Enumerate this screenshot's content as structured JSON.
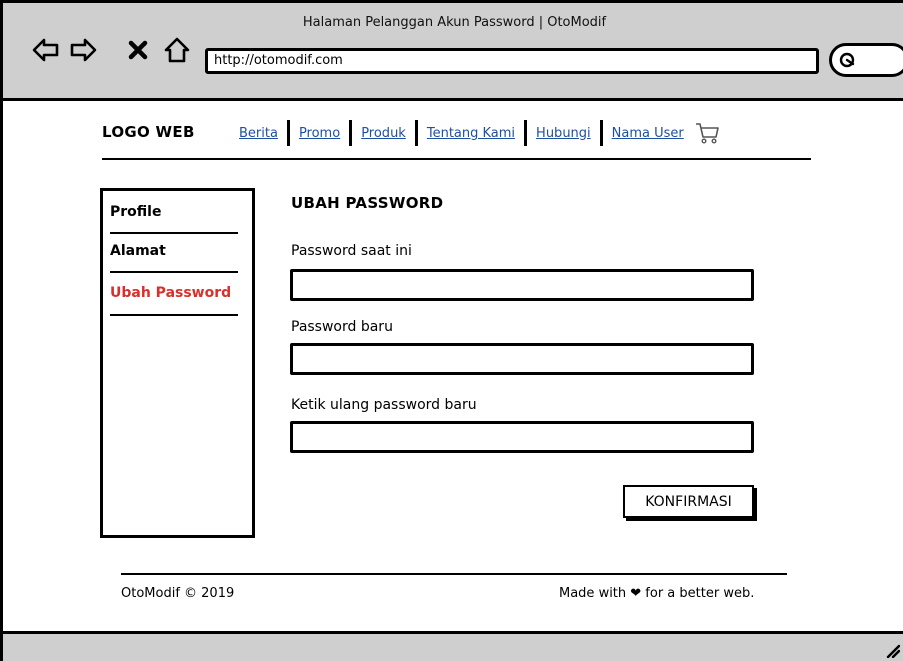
{
  "browser": {
    "window_title": "Halaman Pelanggan Akun Password | OtoModif",
    "url": "http://otomodif.com",
    "icons": {
      "back": "back-arrow-icon",
      "forward": "forward-arrow-icon",
      "stop": "close-icon",
      "home": "home-icon",
      "search": "search-icon"
    }
  },
  "header": {
    "logo": "LOGO WEB",
    "nav": [
      {
        "label": "Berita"
      },
      {
        "label": "Promo"
      },
      {
        "label": "Produk"
      },
      {
        "label": "Tentang Kami"
      },
      {
        "label": "Hubungi"
      },
      {
        "label": "Nama User"
      }
    ],
    "cart_icon": "cart-icon",
    "link_color": "#1f4fa3"
  },
  "sidebar": {
    "items": [
      {
        "label": "Profile",
        "active": false
      },
      {
        "label": "Alamat",
        "active": false
      },
      {
        "label": "Ubah Password",
        "active": true
      }
    ],
    "active_color": "#d9302c"
  },
  "form": {
    "title": "UBAH PASSWORD",
    "fields": [
      {
        "label": "Password saat ini",
        "value": ""
      },
      {
        "label": "Password baru",
        "value": ""
      },
      {
        "label": "Ketik ulang password baru",
        "value": ""
      }
    ],
    "submit_label": "KONFIRMASI"
  },
  "footer": {
    "left": "OtoModif © 2019",
    "right": "Made with ❤ for a better web."
  }
}
